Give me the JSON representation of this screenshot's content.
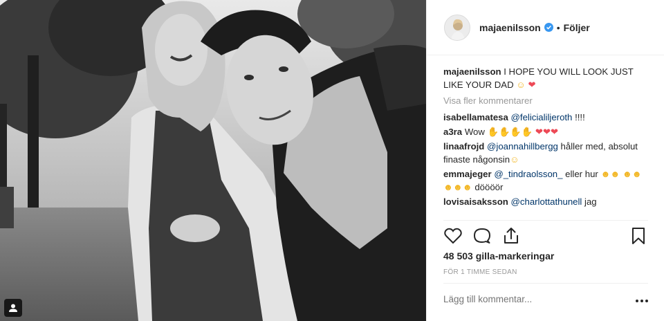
{
  "header": {
    "username": "majaenilsson",
    "separator": "•",
    "follow_label": "Följer"
  },
  "caption": {
    "username": "majaenilsson",
    "text": "I HOPE YOU WILL LOOK JUST LIKE YOUR DAD"
  },
  "view_more_comments": "Visa fler kommentarer",
  "comments": [
    {
      "username": "isabellamatesa",
      "mention": "@felicialiljeroth",
      "text": "!!!!"
    },
    {
      "username": "a3ra",
      "mention": "",
      "text": "Wow"
    },
    {
      "username": "linaafrojd",
      "mention": "@joannahillbergg",
      "text": "håller med, absolut finaste någonsin"
    },
    {
      "username": "emmajeger",
      "mention": "@_tindraolsson_",
      "text": "eller hur",
      "text2": "döööör"
    },
    {
      "username": "lovisaisaksson",
      "mention": "@charlottathunell",
      "text": "jag"
    }
  ],
  "likes": "48 503 gilla-markeringar",
  "timestamp": "FÖR 1 TIMME SEDAN",
  "add_comment_placeholder": "Lägg till kommentar...",
  "colors": {
    "text": "#262626",
    "muted": "#999999",
    "mention": "#003569",
    "verified": "#3897f0",
    "heart": "#ed4956",
    "border": "#efefef"
  },
  "icons": {
    "tag": "person-tag-icon",
    "verified": "verified-badge-icon",
    "like": "heart-outline-icon",
    "comment": "comment-bubble-icon",
    "share": "share-icon",
    "save": "bookmark-icon",
    "more": "more-options-icon"
  }
}
